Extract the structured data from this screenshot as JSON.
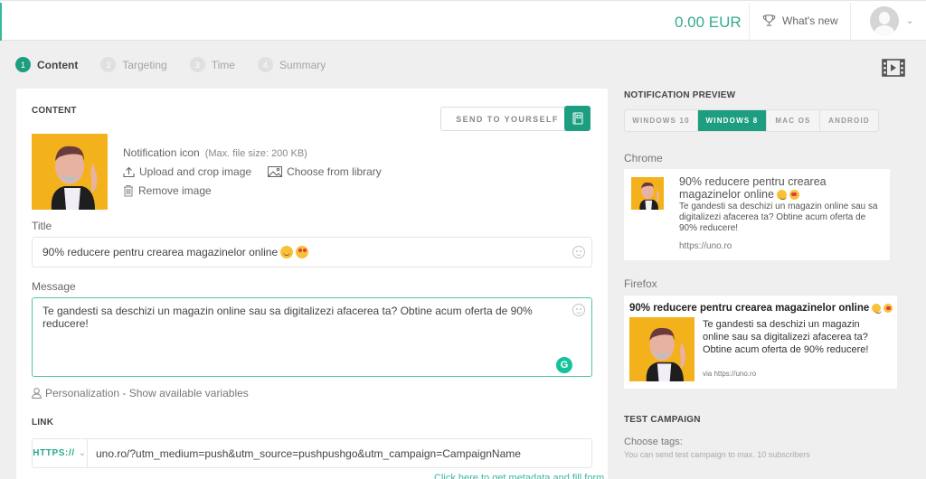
{
  "topbar": {
    "balance": "0.00 EUR",
    "whats_new": "What's new",
    "accent_color": "#1e9e80"
  },
  "steps": [
    {
      "num": "1",
      "label": "Content",
      "active": true
    },
    {
      "num": "2",
      "label": "Targeting",
      "active": false
    },
    {
      "num": "3",
      "label": "Time",
      "active": false
    },
    {
      "num": "4",
      "label": "Summary",
      "active": false
    }
  ],
  "content": {
    "heading": "CONTENT",
    "send_to_yourself": "SEND TO YOURSELF",
    "icon_label": "Notification icon",
    "icon_hint": "(Max. file size: 200 KB)",
    "upload": "Upload and crop image",
    "library": "Choose from library",
    "remove": "Remove image",
    "title_label": "Title",
    "title_value": "90% reducere pentru crearea magazinelor online",
    "message_label": "Message",
    "message_value": "Te gandesti sa deschizi un magazin online sau sa digitalizezi afacerea ta? Obtine acum oferta de 90% reducere!",
    "personalization": "Personalization - Show available variables",
    "grammarly_letter": "G"
  },
  "link": {
    "heading": "LINK",
    "protocol": "HTTPS://",
    "url": "uno.ro/?utm_medium=push&utm_source=pushpushgo&utm_campaign=CampaignName",
    "metadata_link": "Click here to get metadata and fill form"
  },
  "preview": {
    "heading": "NOTIFICATION PREVIEW",
    "os_tabs": [
      {
        "label": "WINDOWS 10",
        "active": false
      },
      {
        "label": "WINDOWS 8",
        "active": true
      },
      {
        "label": "MAC OS",
        "active": false
      },
      {
        "label": "ANDROID",
        "active": false
      }
    ],
    "chrome": {
      "label": "Chrome",
      "title": "90% reducere pentru crearea magazinelor online",
      "message": "Te gandesti sa deschizi un magazin online sau sa digitalizezi afacerea ta? Obtine acum oferta de 90% reducere!",
      "url": "https://uno.ro"
    },
    "firefox": {
      "label": "Firefox",
      "title": "90% reducere pentru crearea magazinelor online",
      "message": "Te gandesti sa deschizi un magazin online sau sa digitalizezi afacerea ta? Obtine acum oferta de 90% reducere!",
      "url": "via https://uno.ro"
    }
  },
  "test_campaign": {
    "heading": "TEST CAMPAIGN",
    "choose_tags": "Choose tags:",
    "note": "You can send test campaign to max. 10 subscribers"
  }
}
